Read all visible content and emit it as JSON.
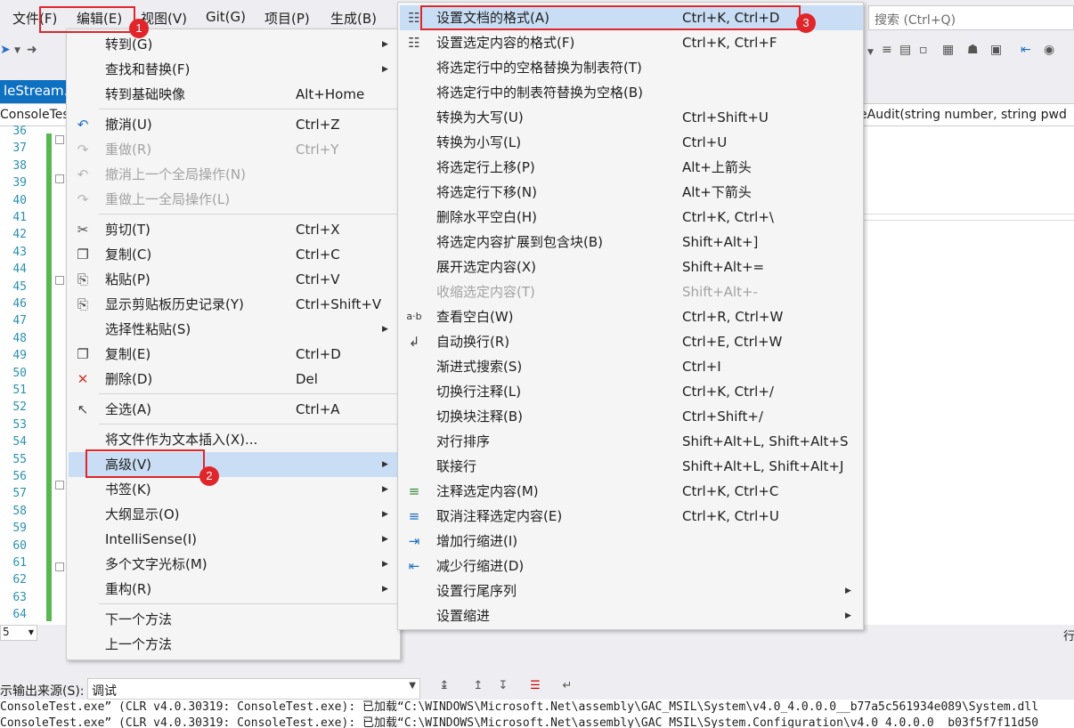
{
  "menubar": {
    "items": [
      "文件(F)",
      "编辑(E)",
      "视图(V)",
      "Git(G)",
      "项目(P)",
      "生成(B)"
    ],
    "search_placeholder": "搜索 (Ctrl+Q)"
  },
  "tab": {
    "label": "leStream.c"
  },
  "navbar": {
    "left": "ConsoleTes",
    "right": "eAudit(string number, string pwd"
  },
  "line_numbers": [
    "36",
    "37",
    "38",
    "39",
    "40",
    "41",
    "42",
    "43",
    "44",
    "45",
    "46",
    "47",
    "48",
    "49",
    "50",
    "51",
    "52",
    "53",
    "54",
    "55",
    "56",
    "57",
    "58",
    "59",
    "60",
    "61",
    "62",
    "63",
    "64"
  ],
  "edit_menu": {
    "items": [
      {
        "label": "转到(G)",
        "shortcut": "",
        "submenu": true,
        "icon": ""
      },
      {
        "label": "查找和替换(F)",
        "shortcut": "",
        "submenu": true,
        "icon": ""
      },
      {
        "label": "转到基础映像",
        "shortcut": "Alt+Home",
        "icon": ""
      },
      {
        "label": "撤消(U)",
        "shortcut": "Ctrl+Z",
        "icon": "undo-icon"
      },
      {
        "label": "重做(R)",
        "shortcut": "Ctrl+Y",
        "icon": "redo-icon",
        "disabled": true
      },
      {
        "label": "撤消上一个全局操作(N)",
        "shortcut": "",
        "icon": "undo-global-icon",
        "disabled": true
      },
      {
        "label": "重做上一全局操作(L)",
        "shortcut": "",
        "icon": "redo-global-icon",
        "disabled": true
      },
      {
        "label": "剪切(T)",
        "shortcut": "Ctrl+X",
        "icon": "scissors-icon"
      },
      {
        "label": "复制(C)",
        "shortcut": "Ctrl+C",
        "icon": "copy-icon"
      },
      {
        "label": "粘贴(P)",
        "shortcut": "Ctrl+V",
        "icon": "paste-icon"
      },
      {
        "label": "显示剪贴板历史记录(Y)",
        "shortcut": "Ctrl+Shift+V",
        "icon": "clipboard-history-icon"
      },
      {
        "label": "选择性粘贴(S)",
        "shortcut": "",
        "submenu": true,
        "icon": ""
      },
      {
        "label": "复制(E)",
        "shortcut": "Ctrl+D",
        "icon": "duplicate-icon"
      },
      {
        "label": "删除(D)",
        "shortcut": "Del",
        "icon": "delete-icon"
      },
      {
        "label": "全选(A)",
        "shortcut": "Ctrl+A",
        "icon": "select-all-icon"
      },
      {
        "label": "将文件作为文本插入(X)...",
        "shortcut": "",
        "icon": ""
      },
      {
        "label": "高级(V)",
        "shortcut": "",
        "submenu": true,
        "icon": "",
        "highlighted": true
      },
      {
        "label": "书签(K)",
        "shortcut": "",
        "submenu": true,
        "icon": ""
      },
      {
        "label": "大纲显示(O)",
        "shortcut": "",
        "submenu": true,
        "icon": ""
      },
      {
        "label": "IntelliSense(I)",
        "shortcut": "",
        "submenu": true,
        "icon": ""
      },
      {
        "label": "多个文字光标(M)",
        "shortcut": "",
        "submenu": true,
        "icon": ""
      },
      {
        "label": "重构(R)",
        "shortcut": "",
        "submenu": true,
        "icon": ""
      },
      {
        "label": "下一个方法",
        "shortcut": "",
        "icon": ""
      },
      {
        "label": "上一个方法",
        "shortcut": "",
        "icon": ""
      }
    ]
  },
  "advanced_menu": {
    "items": [
      {
        "label": "设置文档的格式(A)",
        "shortcut": "Ctrl+K, Ctrl+D",
        "icon": "format-document-icon",
        "highlighted": true
      },
      {
        "label": "设置选定内容的格式(F)",
        "shortcut": "Ctrl+K, Ctrl+F",
        "icon": "format-selection-icon"
      },
      {
        "label": "将选定行中的空格替换为制表符(T)",
        "shortcut": "",
        "icon": ""
      },
      {
        "label": "将选定行中的制表符替换为空格(B)",
        "shortcut": "",
        "icon": ""
      },
      {
        "label": "转换为大写(U)",
        "shortcut": "Ctrl+Shift+U",
        "icon": ""
      },
      {
        "label": "转换为小写(L)",
        "shortcut": "Ctrl+U",
        "icon": ""
      },
      {
        "label": "将选定行上移(P)",
        "shortcut": "Alt+上箭头",
        "icon": ""
      },
      {
        "label": "将选定行下移(N)",
        "shortcut": "Alt+下箭头",
        "icon": ""
      },
      {
        "label": "删除水平空白(H)",
        "shortcut": "Ctrl+K, Ctrl+\\",
        "icon": ""
      },
      {
        "label": "将选定内容扩展到包含块(B)",
        "shortcut": "Shift+Alt+]",
        "icon": ""
      },
      {
        "label": "展开选定内容(X)",
        "shortcut": "Shift+Alt+=",
        "icon": ""
      },
      {
        "label": "收缩选定内容(T)",
        "shortcut": "Shift+Alt+-",
        "icon": "",
        "disabled": true
      },
      {
        "label": "查看空白(W)",
        "shortcut": "Ctrl+R, Ctrl+W",
        "icon": "view-whitespace-icon"
      },
      {
        "label": "自动换行(R)",
        "shortcut": "Ctrl+E, Ctrl+W",
        "icon": "word-wrap-icon"
      },
      {
        "label": "渐进式搜索(S)",
        "shortcut": "Ctrl+I",
        "icon": ""
      },
      {
        "label": "切换行注释(L)",
        "shortcut": "Ctrl+K, Ctrl+/",
        "icon": ""
      },
      {
        "label": "切换块注释(B)",
        "shortcut": "Ctrl+Shift+/",
        "icon": ""
      },
      {
        "label": "对行排序",
        "shortcut": "Shift+Alt+L, Shift+Alt+S",
        "icon": ""
      },
      {
        "label": "联接行",
        "shortcut": "Shift+Alt+L, Shift+Alt+J",
        "icon": ""
      },
      {
        "label": "注释选定内容(M)",
        "shortcut": "Ctrl+K, Ctrl+C",
        "icon": "comment-icon"
      },
      {
        "label": "取消注释选定内容(E)",
        "shortcut": "Ctrl+K, Ctrl+U",
        "icon": "uncomment-icon"
      },
      {
        "label": "增加行缩进(I)",
        "shortcut": "",
        "icon": "indent-icon"
      },
      {
        "label": "减少行缩进(D)",
        "shortcut": "",
        "icon": "outdent-icon"
      },
      {
        "label": "设置行尾序列",
        "shortcut": "",
        "submenu": true,
        "icon": ""
      },
      {
        "label": "设置缩进",
        "shortcut": "",
        "submenu": true,
        "icon": ""
      }
    ]
  },
  "badges": [
    "1",
    "2",
    "3"
  ],
  "status": {
    "zoom": "5",
    "line_label": "行"
  },
  "output": {
    "source_label": "示输出来源(S):",
    "source_value": "调试",
    "lines": [
      "ConsoleTest.exe” (CLR v4.0.30319: ConsoleTest.exe): 已加载“C:\\WINDOWS\\Microsoft.Net\\assembly\\GAC_MSIL\\System\\v4.0_4.0.0.0__b77a5c561934e089\\System.dll",
      "ConsoleTest.exe” (CLR v4.0.30319: ConsoleTest.exe): 已加载“C:\\WINDOWS\\Microsoft.Net\\assembly\\GAC_MSIL\\System.Configuration\\v4.0_4.0.0.0__b03f5f7f11d50"
    ]
  }
}
